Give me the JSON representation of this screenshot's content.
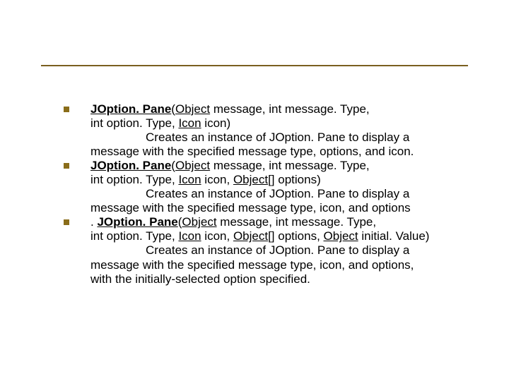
{
  "items": [
    {
      "sigA": "JOption. Pane",
      "sigB": "(",
      "sigC": "Object",
      "sigRest1": " message, int message. Type,",
      "line2a": "int option. Type, ",
      "line2b": "Icon",
      "line2c": " icon)",
      "desc1": "Creates an instance of JOption. Pane to display a",
      "desc2": "message with the specified message type, options, and icon."
    },
    {
      "sigA": "JOption. Pane",
      "sigB": "(",
      "sigC": "Object",
      "sigRest1": " message, int message. Type,",
      "line2a": "int option. Type, ",
      "line2b": "Icon",
      "line2c": " icon, ",
      "line2d": "Object",
      "line2e": "[] options)",
      "desc1": "Creates an instance of JOption. Pane to display a",
      "desc2": "message with the specified message type, icon, and options"
    },
    {
      "lead": ". ",
      "sigA": "JOption. Pane",
      "sigB": "(",
      "sigC": "Object",
      "sigRest1": " message, int message. Type,",
      "line2a": "int option. Type, ",
      "line2b": "Icon",
      "line2c": " icon, ",
      "line2d": "Object",
      "line2e": "[] options, ",
      "line2f": "Object",
      "line2g": " initial. Value)",
      "desc1": "Creates an instance of JOption. Pane to display a",
      "desc2": "message with the specified message type, icon, and options,",
      "desc3": "with the initially-selected option specified."
    }
  ]
}
